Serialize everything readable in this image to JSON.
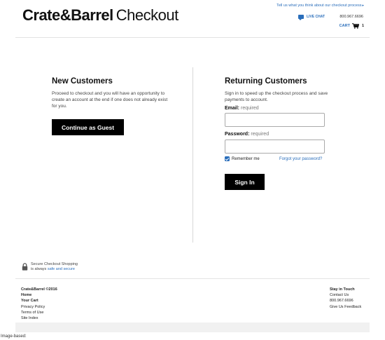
{
  "header": {
    "logo_brand": "Crate&Barrel",
    "logo_suffix": "Checkout",
    "feedback_link": "Tell us what you think about our checkout process",
    "livechat_label": "LIVE CHAT",
    "phone": "800.967.6696",
    "cart_label": "CART",
    "cart_count": "1",
    "icons": {
      "chat": "chat-bubble-icon",
      "cart": "shopping-cart-icon"
    }
  },
  "new_customers": {
    "title": "New Customers",
    "description": "Proceed to checkout and you will have an opportunity to create an account at the end if one does not already exist for you.",
    "guest_button": "Continue as Guest"
  },
  "returning_customers": {
    "title": "Returning Customers",
    "description": "Sign in to speed up the checkout process and save payments to account.",
    "email_label": "Email:",
    "email_required": "required",
    "email_value": "",
    "password_label": "Password:",
    "password_required": "required",
    "password_value": "",
    "remember_label": "Remember me",
    "remember_checked": true,
    "forgot_link": "Forgot your password?",
    "signin_button": "Sign In"
  },
  "secure": {
    "line1": "Secure Checkout Shopping",
    "line2_prefix": "is always",
    "line2_link": "safe and secure",
    "icon": "lock-icon"
  },
  "footer": {
    "copyright": "Crate&Barrel ©2016",
    "home": "Home",
    "your_cart": "Your Cart",
    "privacy": "Privacy Policy",
    "terms": "Terms of Use",
    "site_index": "Site Index",
    "stay_in_touch": "Stay in Touch",
    "contact_us": "Contact Us",
    "phone": "800.967.6696",
    "feedback": "Give Us Feedback"
  },
  "caption": "Image-based:",
  "colors": {
    "link": "#2a6ebb",
    "button": "#000000",
    "divider": "#d8d8d8"
  }
}
